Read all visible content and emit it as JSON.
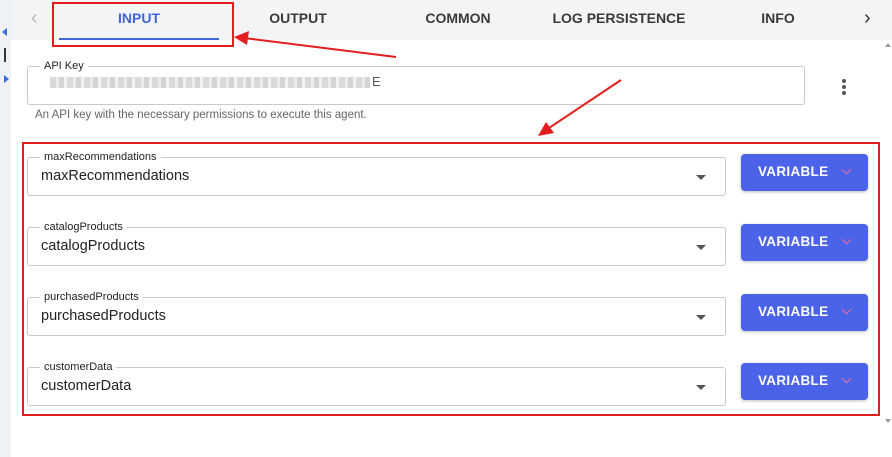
{
  "tabs": [
    {
      "label": "INPUT",
      "active": true
    },
    {
      "label": "OUTPUT",
      "active": false
    },
    {
      "label": "COMMON",
      "active": false
    },
    {
      "label": "LOG PERSISTENCE",
      "active": false
    },
    {
      "label": "INFO",
      "active": false
    }
  ],
  "nav": {
    "prev_icon": "chevron-left-icon",
    "next_icon": "chevron-right-icon",
    "prev_glyph": "‹",
    "next_glyph": "›"
  },
  "api_key": {
    "legend": "API Key",
    "masked_tail": "E",
    "helper": "An API key with the necessary permissions to execute this agent."
  },
  "inputs": [
    {
      "legend": "maxRecommendations",
      "value": "maxRecommendations",
      "button": "VARIABLE"
    },
    {
      "legend": "catalogProducts",
      "value": "catalogProducts",
      "button": "VARIABLE"
    },
    {
      "legend": "purchasedProducts",
      "value": "purchasedProducts",
      "button": "VARIABLE"
    },
    {
      "legend": "customerData",
      "value": "customerData",
      "button": "VARIABLE"
    }
  ],
  "colors": {
    "accent": "#3f66d6",
    "button": "#4a63e8",
    "annotation": "#e01e1e",
    "tabbar": "#f3f4f6"
  }
}
